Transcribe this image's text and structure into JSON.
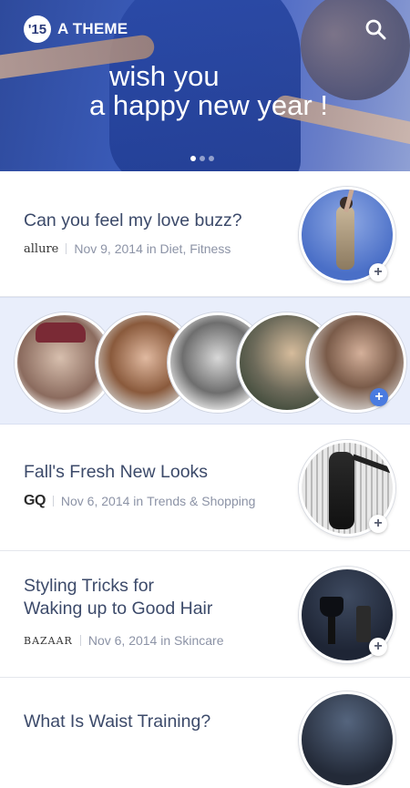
{
  "header": {
    "logo_badge": "'15",
    "logo_text": "A THEME",
    "search_icon": "search-icon"
  },
  "hero": {
    "line1": "wish you",
    "line2": "a happy new year !",
    "slides": 3,
    "active_slide": 1
  },
  "articles": [
    {
      "title_lines": [
        "Can you feel my love buzz?"
      ],
      "publisher": "allure",
      "date": "Nov 9, 2014",
      "in_label": "in",
      "category": "Diet, Fitness"
    },
    {
      "title_lines": [
        "Fall's Fresh New Looks"
      ],
      "publisher": "GQ",
      "date": "Nov 6, 2014",
      "in_label": "in",
      "category": "Trends & Shopping"
    },
    {
      "title_lines": [
        "Styling Tricks for",
        "Waking up to Good Hair"
      ],
      "publisher": "BAZAAR",
      "date": "Nov 6, 2014",
      "in_label": "in",
      "category": "Skincare"
    },
    {
      "title_lines": [
        "What Is Waist Training?"
      ]
    }
  ],
  "plus_label": "+",
  "colors": {
    "title": "#3c4a6a",
    "meta": "#8c93a6",
    "strip_bg": "#e9eefb",
    "accent_plus": "#4a7be0"
  }
}
